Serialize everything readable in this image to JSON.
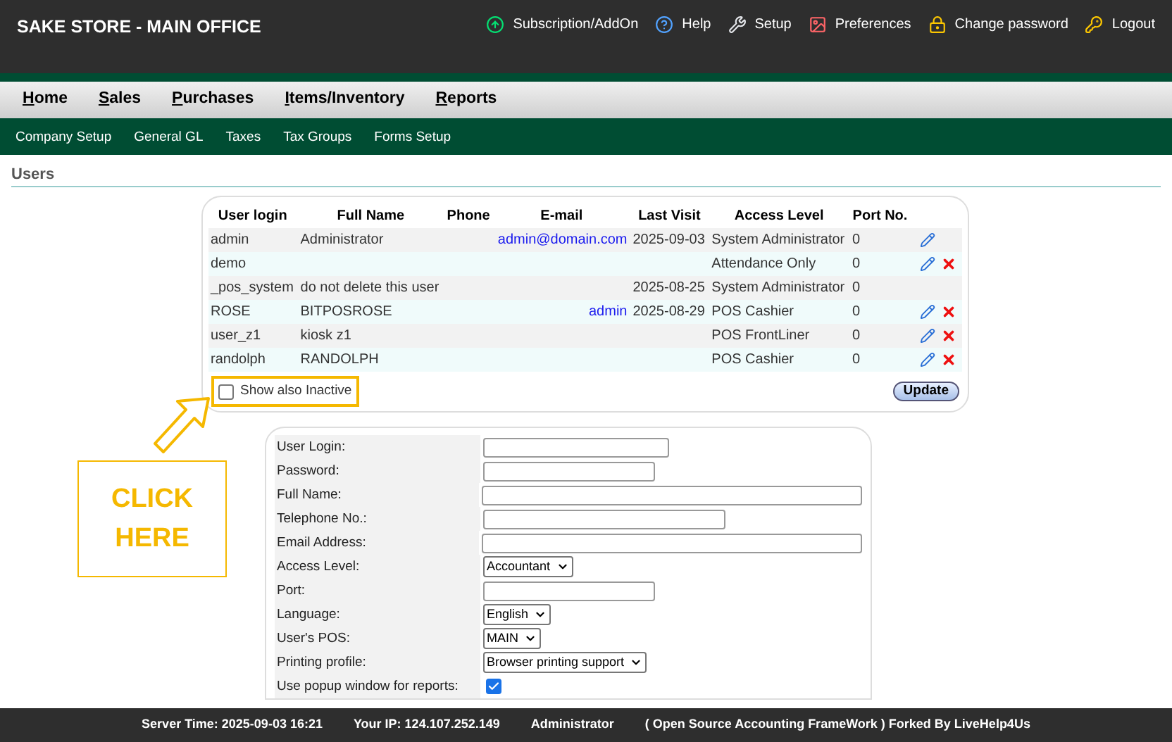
{
  "header": {
    "title": "SAKE STORE - MAIN OFFICE",
    "links": [
      {
        "label": "Subscription/AddOn",
        "kind": "addon"
      },
      {
        "label": "Help",
        "kind": "help"
      },
      {
        "label": "Setup",
        "kind": "setup"
      },
      {
        "label": "Preferences",
        "kind": "preferences"
      },
      {
        "label": "Change password",
        "kind": "password"
      },
      {
        "label": "Logout",
        "kind": "logout"
      }
    ]
  },
  "menu": [
    "Home",
    "Sales",
    "Purchases",
    "Items/Inventory",
    "Reports"
  ],
  "submenu": [
    "Company Setup",
    "General GL",
    "Taxes",
    "Tax Groups",
    "Forms Setup"
  ],
  "page_title": "Users",
  "table": {
    "columns": [
      "User login",
      "Full Name",
      "Phone",
      "E-mail",
      "Last Visit",
      "Access Level",
      "Port No."
    ],
    "rows": [
      {
        "login": "admin",
        "full_name": "Administrator",
        "phone": "",
        "email": "admin@domain.com",
        "last_visit": "2025-09-03",
        "access": "System Administrator",
        "port": "0",
        "edit": true,
        "delete": false
      },
      {
        "login": "demo",
        "full_name": "",
        "phone": "",
        "email": "",
        "last_visit": "",
        "access": "Attendance Only",
        "port": "0",
        "edit": true,
        "delete": true
      },
      {
        "login": "_pos_system",
        "full_name": "do not delete this user",
        "phone": "",
        "email": "",
        "last_visit": "2025-08-25",
        "access": "System Administrator",
        "port": "0",
        "edit": false,
        "delete": false
      },
      {
        "login": "ROSE",
        "full_name": "BITPOSROSE",
        "phone": "",
        "email": "admin",
        "last_visit": "2025-08-29",
        "access": "POS Cashier",
        "port": "0",
        "edit": true,
        "delete": true
      },
      {
        "login": "user_z1",
        "full_name": "kiosk z1",
        "phone": "",
        "email": "",
        "last_visit": "",
        "access": "POS FrontLiner",
        "port": "0",
        "edit": true,
        "delete": true
      },
      {
        "login": "randolph",
        "full_name": "RANDOLPH",
        "phone": "",
        "email": "",
        "last_visit": "",
        "access": "POS Cashier",
        "port": "0",
        "edit": true,
        "delete": true
      }
    ],
    "show_inactive": {
      "label": "Show also Inactive",
      "checked": false
    },
    "update_button": "Update"
  },
  "callout": {
    "text": "CLICK HERE"
  },
  "form": [
    {
      "label": "User Login:",
      "kind": "text"
    },
    {
      "label": "Password:",
      "kind": "text"
    },
    {
      "label": "Full Name:",
      "kind": "text"
    },
    {
      "label": "Telephone No.:",
      "kind": "text"
    },
    {
      "label": "Email Address:",
      "kind": "text"
    },
    {
      "label": "Access Level:",
      "kind": "select",
      "value": "Accountant"
    },
    {
      "label": "Port:",
      "kind": "text"
    },
    {
      "label": "Language:",
      "kind": "select",
      "value": "English"
    },
    {
      "label": "User's POS:",
      "kind": "select",
      "value": "MAIN"
    },
    {
      "label": "Printing profile:",
      "kind": "select",
      "value": "Browser printing support"
    },
    {
      "label": "Use popup window for reports:",
      "kind": "checkbox",
      "checked": true
    }
  ],
  "footer": {
    "server_time": "Server Time: 2025-09-03 16:21",
    "ip": "Your IP: 124.107.252.149",
    "user": "Administrator",
    "credit": "( Open Source Accounting FrameWork ) Forked By LiveHelp4Us"
  }
}
